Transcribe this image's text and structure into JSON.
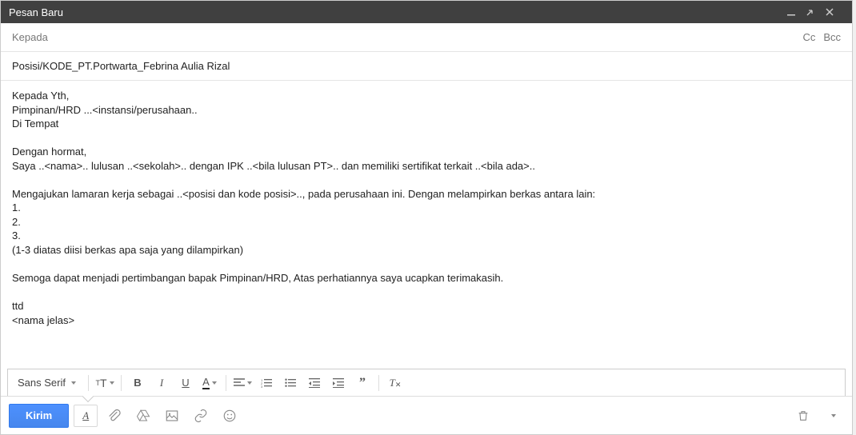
{
  "header": {
    "title": "Pesan Baru"
  },
  "recipients": {
    "to_placeholder": "Kepada",
    "cc_label": "Cc",
    "bcc_label": "Bcc"
  },
  "subject": {
    "value": "Posisi/KODE_PT.Portwarta_Febrina Aulia Rizal"
  },
  "body": {
    "text": "Kepada Yth,\nPimpinan/HRD ...<instansi/perusahaan..\nDi Tempat\n\nDengan hormat,\nSaya ..<nama>.. lulusan ..<sekolah>.. dengan IPK ..<bila lulusan PT>.. dan memiliki sertifikat terkait ..<bila ada>..\n\nMengajukan lamaran kerja sebagai ..<posisi dan kode posisi>.., pada perusahaan ini. Dengan melampirkan berkas antara lain:\n1.\n2.\n3.\n(1-3 diatas diisi berkas apa saja yang dilampirkan)\n\nSemoga dapat menjadi pertimbangan bapak Pimpinan/HRD, Atas perhatiannya saya ucapkan terimakasih.\n\nttd\n<nama jelas>"
  },
  "format_toolbar": {
    "font_label": "Sans Serif"
  },
  "bottom_bar": {
    "send_label": "Kirim"
  }
}
